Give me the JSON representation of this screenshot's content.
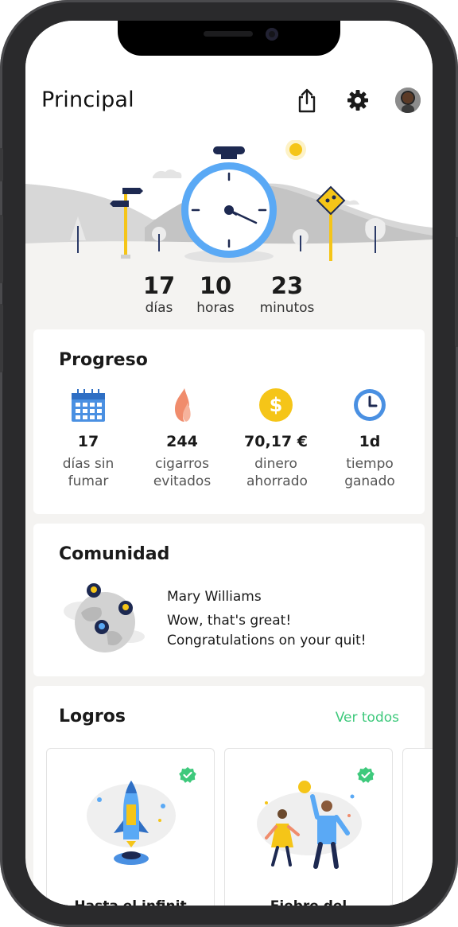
{
  "header": {
    "title": "Principal"
  },
  "timer": {
    "days_value": "17",
    "days_label": "días",
    "hours_value": "10",
    "hours_label": "horas",
    "minutes_value": "23",
    "minutes_label": "minutos"
  },
  "progress": {
    "title": "Progreso",
    "stats": [
      {
        "icon": "calendar-icon",
        "value": "17",
        "label": "días sin fumar"
      },
      {
        "icon": "flame-icon",
        "value": "244",
        "label": "cigarros evitados"
      },
      {
        "icon": "dollar-coin-icon",
        "value": "70,17 €",
        "label": "dinero ahorrado"
      },
      {
        "icon": "clock-icon",
        "value": "1d",
        "label": "tiempo ganado"
      }
    ]
  },
  "community": {
    "title": "Comunidad",
    "author": "Mary Williams",
    "message_line1": "Wow, that's great!",
    "message_line2": "Congratulations on your quit!"
  },
  "achievements": {
    "title": "Logros",
    "see_all": "Ver todos",
    "items": [
      {
        "title": "Hasta el infinit",
        "illustration": "rocket-illustration",
        "completed": true
      },
      {
        "title": "Fiebre del",
        "illustration": "dancing-couple-illustration",
        "completed": true
      }
    ]
  },
  "colors": {
    "accent_green": "#3ec97c",
    "clock_blue": "#5aa9f5",
    "sign_yellow": "#f5c518",
    "flame": "#f08c6c"
  }
}
